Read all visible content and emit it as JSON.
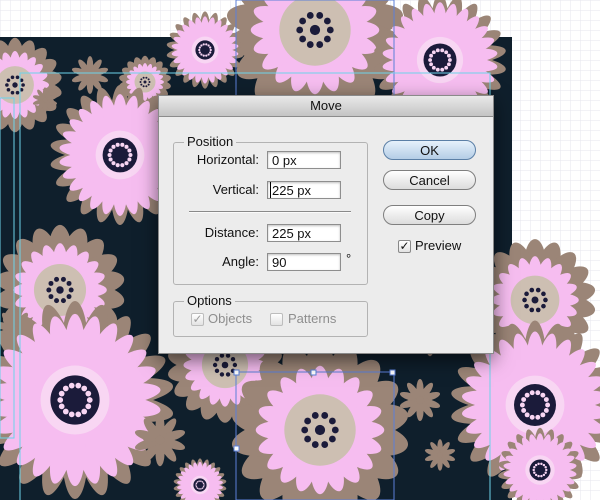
{
  "colors": {
    "pattern_background": "#0f1f2c",
    "petal_pink": "#f6bdf0",
    "petal_brown": "#9b8577",
    "center_beige": "#cdbfb2",
    "selection_cyan": "#6cd3ea",
    "selection_blue": "#5b7fd8",
    "cursor_highlight": "#e23cc4"
  },
  "dialog": {
    "title": "Move",
    "position_group": {
      "legend": "Position",
      "horizontal_label": "Horizontal:",
      "horizontal_value": "0 px",
      "vertical_label": "Vertical:",
      "vertical_value": "225 px",
      "distance_label": "Distance:",
      "distance_value": "225 px",
      "angle_label": "Angle:",
      "angle_value": "90",
      "angle_unit": "°"
    },
    "options_group": {
      "legend": "Options",
      "objects_label": "Objects",
      "objects_checked": true,
      "patterns_label": "Patterns",
      "patterns_checked": false
    },
    "buttons": {
      "ok": "OK",
      "cancel": "Cancel",
      "copy": "Copy"
    },
    "preview_label": "Preview",
    "preview_checked": true
  }
}
